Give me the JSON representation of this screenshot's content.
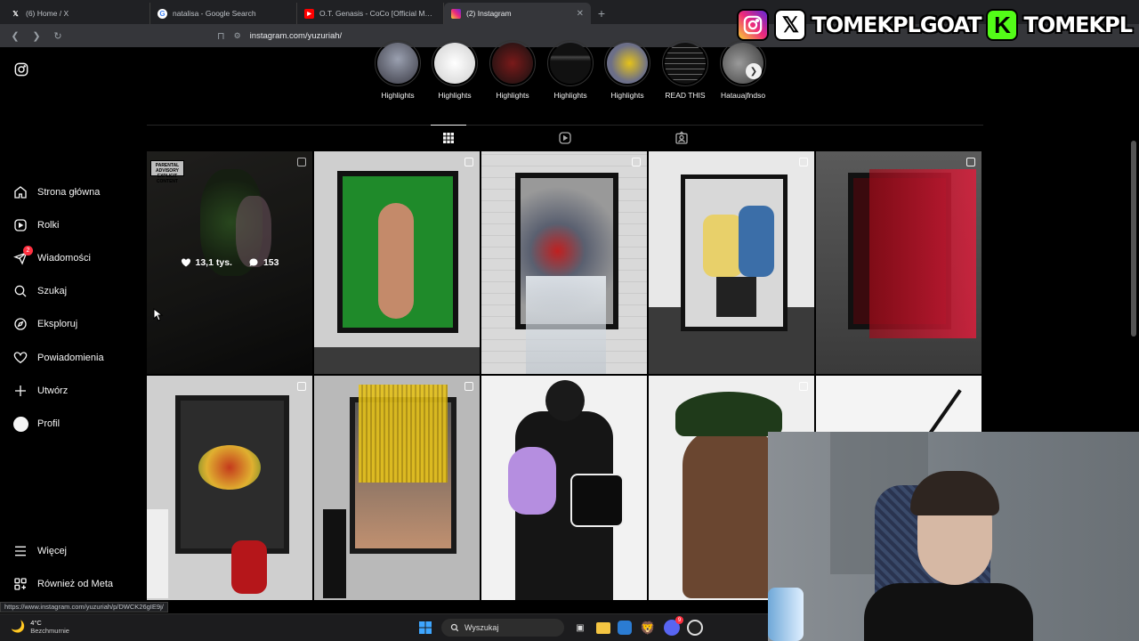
{
  "browser": {
    "tabs": [
      {
        "title": "(6) Home / X",
        "icon": "x-logo-icon",
        "active": false
      },
      {
        "title": "natalisa - Google Search",
        "icon": "google-icon",
        "active": false
      },
      {
        "title": "O.T. Genasis - CoCo [Official Music V",
        "icon": "youtube-icon",
        "active": false
      },
      {
        "title": "(2) Instagram",
        "icon": "instagram-icon",
        "active": true
      }
    ],
    "url": "instagram.com/yuzuriah/",
    "status_url": "https://www.instagram.com/yuzuriah/p/DWCK26gIE9j/"
  },
  "overlay": {
    "handle_x": "TOMEKPLGOAT",
    "handle_kick": "TOMEKPL",
    "k_letter": "K"
  },
  "sidebar": {
    "items": [
      {
        "label": "Strona główna",
        "icon": "home-icon"
      },
      {
        "label": "Rolki",
        "icon": "reels-icon"
      },
      {
        "label": "Wiadomości",
        "icon": "messenger-icon",
        "badge": "2"
      },
      {
        "label": "Szukaj",
        "icon": "search-icon"
      },
      {
        "label": "Eksploruj",
        "icon": "compass-icon"
      },
      {
        "label": "Powiadomienia",
        "icon": "heart-icon"
      },
      {
        "label": "Utwórz",
        "icon": "plus-icon"
      },
      {
        "label": "Profil",
        "icon": "avatar-icon"
      }
    ],
    "bottom": [
      {
        "label": "Więcej",
        "icon": "menu-icon"
      },
      {
        "label": "Również od Meta",
        "icon": "meta-grid-icon"
      }
    ]
  },
  "highlights": [
    {
      "label": "Highlights",
      "color": "#6b6f7a"
    },
    {
      "label": "Highlights",
      "color": "#e8e8e8"
    },
    {
      "label": "Highlights",
      "color": "#5a1515"
    },
    {
      "label": "Highlights",
      "color": "#2a2a2a"
    },
    {
      "label": "Highlights",
      "color": "#8c8fa8"
    },
    {
      "label": "READ THIS",
      "color": "#111111"
    },
    {
      "label": "Hatauajfndso",
      "color": "#707070"
    }
  ],
  "profile_tabs": [
    "grid-icon",
    "reels-icon",
    "tagged-icon"
  ],
  "posts": [
    {
      "likes": "13,1 tys.",
      "comments": "153",
      "advisory": "PARENTAL ADVISORY EXPLICIT CONTENT",
      "color": "#262624",
      "accent": "#3a6a2a"
    },
    {
      "color": "#cfcfcf",
      "accent": "#1f8a2a"
    },
    {
      "color": "#d9d9d9",
      "accent": "#c02020"
    },
    {
      "color": "#e2e2e2",
      "accent": "#3b6ea8"
    },
    {
      "color": "#4a4a4a",
      "accent": "#9c0d1a"
    },
    {
      "color": "#cfcfcf",
      "accent": "#c43a1c"
    },
    {
      "color": "#b9b9b9",
      "accent": "#e5c21a"
    },
    {
      "color": "#f2f2f2",
      "accent": "#b58ee0"
    },
    {
      "color": "#efefef",
      "accent": "#1f3a1a"
    },
    {
      "color": "#f4f4f4",
      "accent": "#111111"
    }
  ],
  "taskbar": {
    "weather_temp": "4°C",
    "weather_desc": "Bezchmurnie",
    "search_placeholder": "Wyszukaj",
    "discord_badge": "9"
  }
}
